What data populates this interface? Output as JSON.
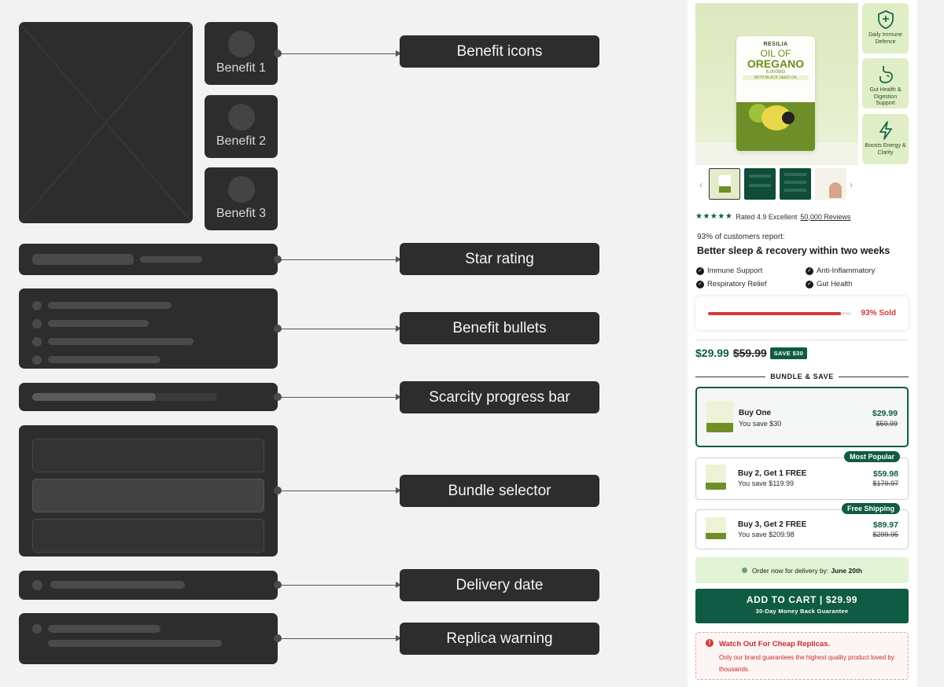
{
  "wireframe": {
    "benefits": [
      "Benefit 1",
      "Benefit 2",
      "Benefit 3"
    ]
  },
  "annotations": {
    "benefit_icons": "Benefit icons",
    "star_rating": "Star rating",
    "benefit_bullets": "Benefit bullets",
    "scarcity": "Scarcity progress bar",
    "bundle_selector": "Bundle selector",
    "delivery_date": "Delivery date",
    "replica_warning": "Replica warning"
  },
  "product": {
    "bag": {
      "brand": "RESILIA",
      "line1": "OIL OF",
      "line2": "OREGANO",
      "line3": "6,000MG",
      "line4": "WITH BLACK SEED OIL"
    },
    "icon_cards": [
      {
        "icon": "shield-plus-icon",
        "label": "Daily Immune Defence"
      },
      {
        "icon": "stomach-icon",
        "label": "Gut Health & Digestion Support"
      },
      {
        "icon": "lightning-icon",
        "label": "Boosts Energy & Clarity"
      }
    ],
    "rating": {
      "stars": "★★★★★",
      "text": "Rated 4.9 Excellent",
      "reviews": "50,000 Reviews"
    },
    "report_line": "93% of customers report:",
    "headline": "Better sleep & recovery within two weeks",
    "bullets": [
      "Immune Support",
      "Anti-Inflammatory",
      "Respiratory Relief",
      "Gut Health"
    ],
    "scarcity": {
      "fraction": 0.93,
      "label": "93% Sold",
      "color": "#d53a3a"
    },
    "price": {
      "current": "$29.99",
      "original": "$59.99",
      "save": "SAVE $30"
    },
    "bundle_heading": "BUNDLE & SAVE",
    "bundles": [
      {
        "name": "Buy One",
        "save": "You save $30",
        "price": "$29.99",
        "was": "$59.99",
        "badge": "",
        "selected": true
      },
      {
        "name": "Buy 2, Get 1 FREE",
        "save": "You save $119.99",
        "price": "$59.98",
        "was": "$179.97",
        "badge": "Most Popular",
        "selected": false
      },
      {
        "name": "Buy 3, Get 2 FREE",
        "save": "You save $209.98",
        "price": "$89.97",
        "was": "$299.95",
        "badge": "Free Shipping",
        "selected": false
      }
    ],
    "delivery": {
      "text": "Order now for delivery by:",
      "date": "June 20th"
    },
    "cart": {
      "label": "ADD TO CART | $29.99",
      "sub": "30-Day Money Back Guarantee"
    },
    "warning": {
      "title": "Watch Out For Cheap Replicas.",
      "body": "Only our brand guarantees the highest quality product loved by thousands."
    },
    "colors": {
      "brand_green": "#0f5b43",
      "alert_red": "#d53a3a",
      "wireframe": "#2d2d2d"
    }
  }
}
